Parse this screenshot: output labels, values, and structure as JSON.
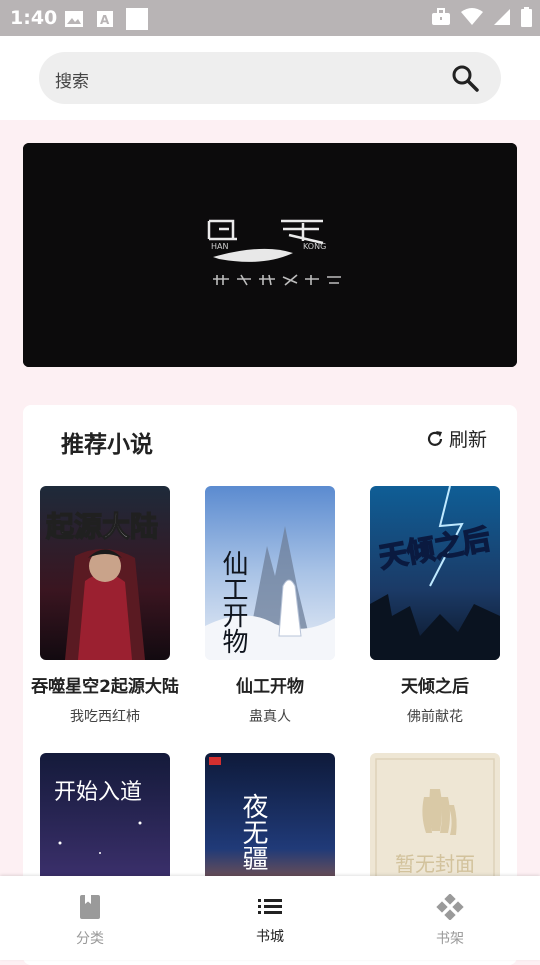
{
  "status_bar": {
    "time": "1:40"
  },
  "search": {
    "placeholder": "搜索"
  },
  "recommend": {
    "title": "推荐小说",
    "refresh_label": "刷新",
    "books": [
      {
        "title": "吞噬星空2起源大陆",
        "author": "我吃西红柿",
        "cover_text": "起源大陆"
      },
      {
        "title": "仙工开物",
        "author": "蛊真人",
        "cover_text": "仙工开物"
      },
      {
        "title": "天倾之后",
        "author": "佛前献花",
        "cover_text": "天倾之后"
      },
      {
        "cover_text": "开始入道"
      },
      {
        "cover_text": "夜无疆"
      },
      {
        "cover_text": "暂无封面"
      }
    ]
  },
  "bottom_nav": [
    {
      "label": "分类",
      "icon": "book-icon",
      "active": false
    },
    {
      "label": "书城",
      "icon": "list-icon",
      "active": true
    },
    {
      "label": "书架",
      "icon": "gamepad-icon",
      "active": false
    }
  ],
  "colors": {
    "accent": "#222222",
    "inactive": "#9a9a9a",
    "page_bg": "#fdf0f3"
  }
}
